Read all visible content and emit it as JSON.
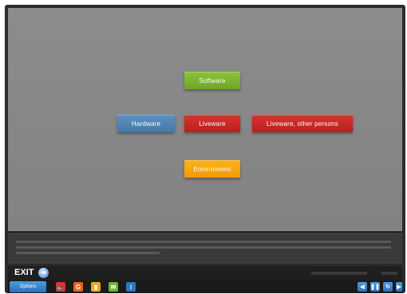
{
  "diagram": {
    "nodes": [
      {
        "id": "software",
        "label": "Software",
        "color": "#7cb733"
      },
      {
        "id": "hardware",
        "label": "Hardware",
        "color": "#4f85b6"
      },
      {
        "id": "liveware",
        "label": "Liveware",
        "color": "#c92a26"
      },
      {
        "id": "liveware_other",
        "label": "Liveware, other persons",
        "color": "#c92a26"
      },
      {
        "id": "environment",
        "label": "Environment",
        "color": "#f7a50c"
      }
    ]
  },
  "exit_bar": {
    "exit_label": "EXIT",
    "exit_icon": "arrow-circle-icon"
  },
  "toolbar": {
    "options_label": "Options",
    "tools": [
      {
        "name": "audio-icon",
        "glyph": "🔈",
        "color": "#d8352a"
      },
      {
        "name": "glossary-icon",
        "glyph": "G",
        "color": "#e8641a"
      },
      {
        "name": "notes-icon",
        "glyph": "▮",
        "color": "#f2a516"
      },
      {
        "name": "comments-icon",
        "glyph": "💬",
        "color": "#6cb33a"
      },
      {
        "name": "info-icon",
        "glyph": "i",
        "color": "#2a78c8"
      }
    ],
    "nav": [
      {
        "name": "previous-icon",
        "glyph": "◀"
      },
      {
        "name": "pause-icon",
        "glyph": "❚❚"
      },
      {
        "name": "replay-icon",
        "glyph": "↻"
      },
      {
        "name": "next-icon",
        "glyph": "▶"
      }
    ]
  }
}
